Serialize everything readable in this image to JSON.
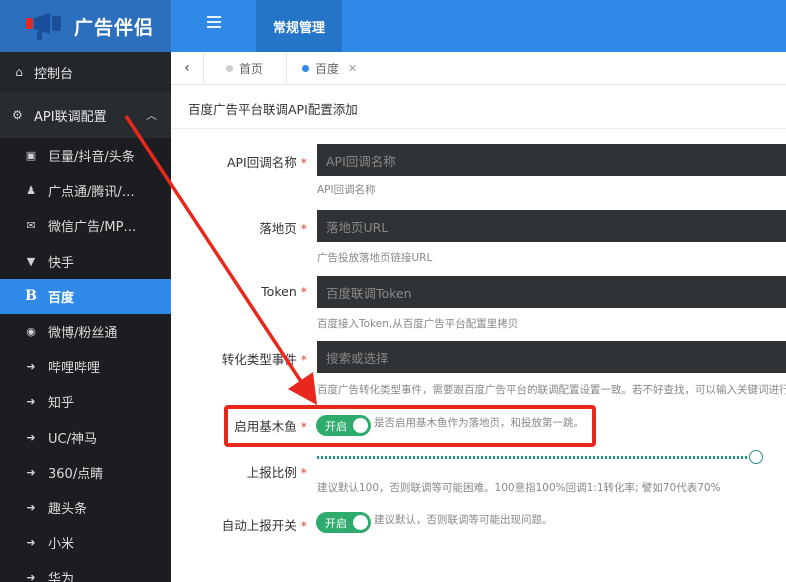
{
  "app": {
    "title": "广告伴侣"
  },
  "header": {
    "menu_icon": "list-icon",
    "active_tab": "常规管理"
  },
  "sidebar": {
    "top_item": {
      "label": "控制台",
      "icon": "home-icon"
    },
    "group": {
      "label": "API联调配置",
      "icon": "gears-icon",
      "chevron": "chevron-up-icon"
    },
    "items": [
      {
        "label": "巨量/抖音/头条",
        "icon": "id-card-icon",
        "glyph": "▣"
      },
      {
        "label": "广点通/腾讯/…",
        "icon": "qq-icon",
        "glyph": "♟"
      },
      {
        "label": "微信广告/MP…",
        "icon": "wechat-icon",
        "glyph": "✉"
      },
      {
        "label": "快手",
        "icon": "vimeo-icon",
        "glyph": "▼"
      },
      {
        "label": "百度",
        "icon": "bold-b-icon",
        "glyph": "B"
      },
      {
        "label": "微博/粉丝通",
        "icon": "weibo-icon",
        "glyph": "◉"
      },
      {
        "label": "哔哩哔哩",
        "icon": "arrow-circle-icon",
        "glyph": "➜"
      },
      {
        "label": "知乎",
        "icon": "arrow-circle-icon",
        "glyph": "➜"
      },
      {
        "label": "UC/神马",
        "icon": "arrow-circle-icon",
        "glyph": "➜"
      },
      {
        "label": "360/点睛",
        "icon": "arrow-circle-icon",
        "glyph": "➜"
      },
      {
        "label": "趣头条",
        "icon": "arrow-circle-icon",
        "glyph": "➜"
      },
      {
        "label": "小米",
        "icon": "arrow-circle-icon",
        "glyph": "➜"
      },
      {
        "label": "华为",
        "icon": "arrow-circle-icon",
        "glyph": "➜"
      }
    ],
    "active_index": 4
  },
  "tabs": {
    "back_icon": "chevron-left-icon",
    "items": [
      {
        "label": "首页",
        "dot_color": "#cfcfcf"
      },
      {
        "label": "百度",
        "dot_color": "#2e8ae6",
        "closable": true
      }
    ]
  },
  "form": {
    "title": "百度广告平台联调API配置添加",
    "fields": {
      "api_name": {
        "label": "API回调名称",
        "placeholder": "API回调名称",
        "help": "API回调名称"
      },
      "landing": {
        "label": "落地页",
        "placeholder": "落地页URL",
        "help": "广告投放落地页链接URL"
      },
      "token": {
        "label": "Token",
        "placeholder": "百度联调Token",
        "help": "百度接入Token,从百度广告平台配置里拷贝"
      },
      "convert": {
        "label": "转化类型事件",
        "placeholder": "搜索或选择",
        "help": "百度广告转化类型事件，需要跟百度广告平台的联调配置设置一致。若不好查找，可以输入关键词进行"
      },
      "jimuyu": {
        "label": "启用基木鱼",
        "switch_label": "开启",
        "help": "是否启用基木鱼作为落地页，和投放第一跳。"
      },
      "ratio": {
        "label": "上报比例",
        "value_percent": 100,
        "help": "建议默认100，否则联调等可能困难。100意指100%回调1:1转化率; 譬如70代表70%"
      },
      "auto": {
        "label": "自动上报开关",
        "switch_label": "开启",
        "help": "建议默认，否则联调等可能出现问题。"
      }
    },
    "required_mark": "*"
  },
  "annotation": {
    "color": "#e8271d"
  }
}
